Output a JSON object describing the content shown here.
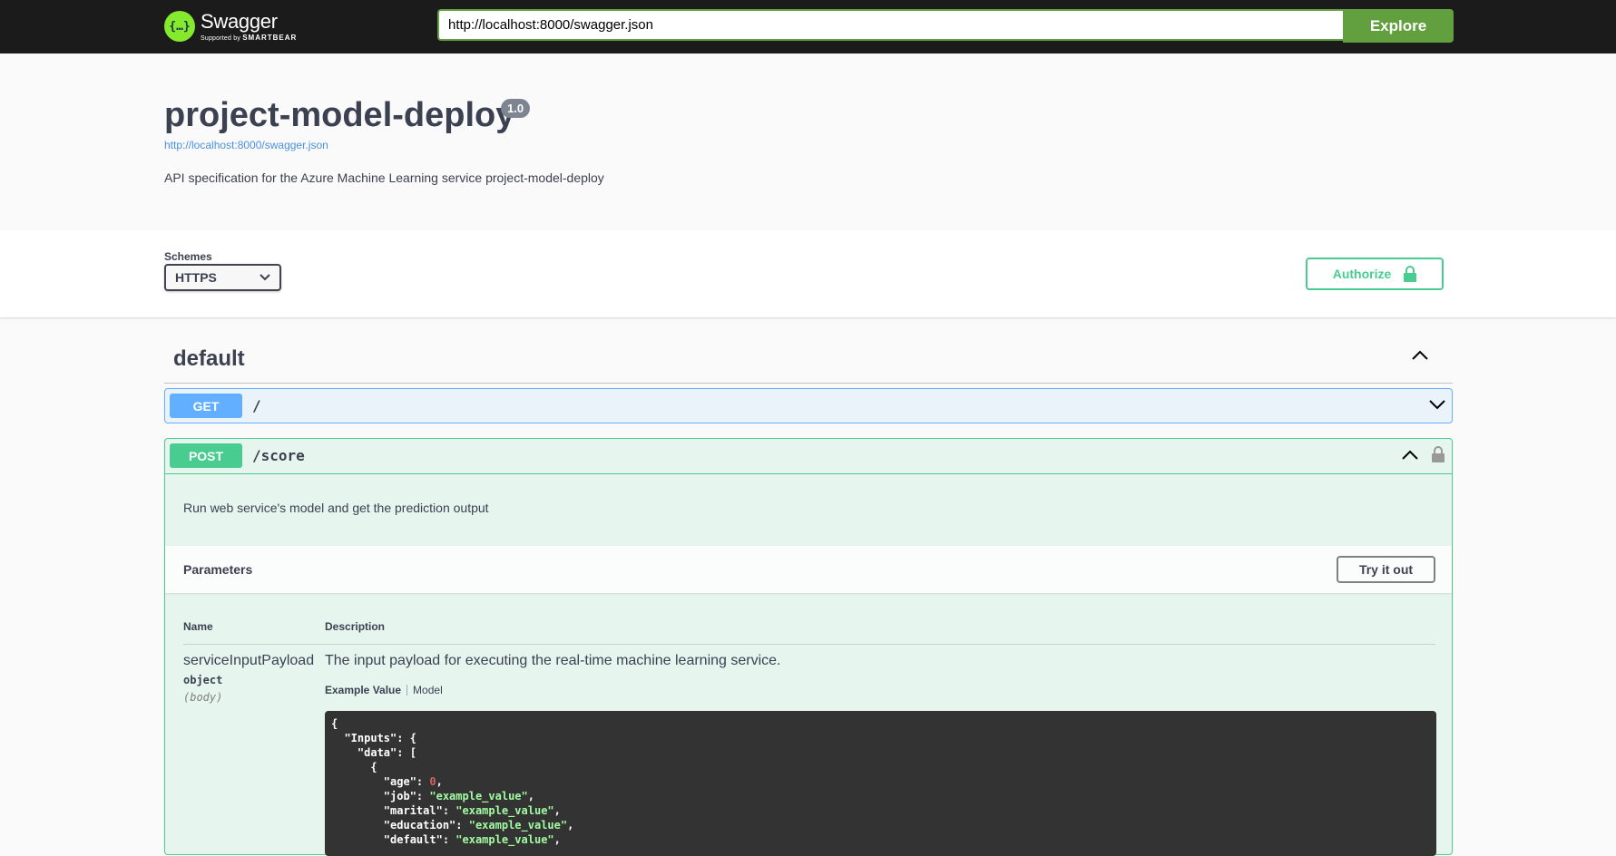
{
  "topbar": {
    "logo_name": "Swagger",
    "logo_sub_prefix": "Supported by",
    "logo_sub_brand": "SMARTBEAR",
    "url_value": "http://localhost:8000/swagger.json",
    "explore_label": "Explore"
  },
  "info": {
    "title": "project-model-deploy",
    "version": "1.0",
    "url": "http://localhost:8000/swagger.json",
    "description": "API specification for the Azure Machine Learning service project-model-deploy"
  },
  "schemes": {
    "label": "Schemes",
    "selected": "HTTPS",
    "authorize_label": "Authorize"
  },
  "tag": {
    "name": "default"
  },
  "operations": {
    "get": {
      "method": "GET",
      "path": "/"
    },
    "post": {
      "method": "POST",
      "path": "/score",
      "description": "Run web service's model and get the prediction output",
      "parameters_title": "Parameters",
      "try_label": "Try it out",
      "col_name": "Name",
      "col_description": "Description",
      "param": {
        "name": "serviceInputPayload",
        "type": "object",
        "in": "(body)",
        "description": "The input payload for executing the real-time machine learning service."
      },
      "tab_example": "Example Value",
      "tab_model": "Model",
      "example_lines": [
        {
          "indent": "",
          "key": "",
          "value": "{",
          "kind": "punct"
        },
        {
          "indent": "  ",
          "key": "\"Inputs\"",
          "value": "{",
          "kind": "punct"
        },
        {
          "indent": "    ",
          "key": "\"data\"",
          "value": "[",
          "kind": "punct"
        },
        {
          "indent": "      ",
          "key": "",
          "value": "{",
          "kind": "punct"
        },
        {
          "indent": "        ",
          "key": "\"age\"",
          "value": "0",
          "kind": "num"
        },
        {
          "indent": "        ",
          "key": "\"job\"",
          "value": "\"example_value\"",
          "kind": "str"
        },
        {
          "indent": "        ",
          "key": "\"marital\"",
          "value": "\"example_value\"",
          "kind": "str"
        },
        {
          "indent": "        ",
          "key": "\"education\"",
          "value": "\"example_value\"",
          "kind": "str"
        },
        {
          "indent": "        ",
          "key": "\"default\"",
          "value": "\"example_value\"",
          "kind": "str"
        }
      ]
    }
  },
  "colors": {
    "get": "#61affe",
    "post": "#49cc90",
    "brand_green": "#62a03f",
    "logo_green": "#85ea2d"
  }
}
